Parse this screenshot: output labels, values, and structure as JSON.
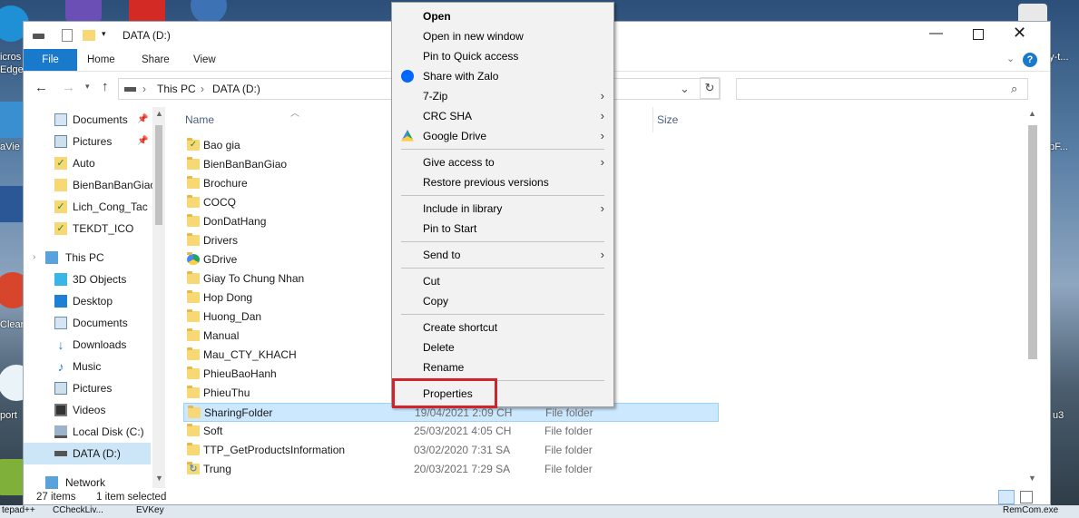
{
  "desktop": {
    "left_labels": [
      "icros",
      "Edge",
      "aVie",
      "Clean",
      "port"
    ],
    "right_labels": [
      "ay-t...",
      "upF...",
      "u3"
    ],
    "taskbar_items": [
      "tepad++",
      "CCheckLiv...",
      "EVKey",
      "RemCom.exe"
    ]
  },
  "window": {
    "title": "DATA (D:)",
    "ribbon_tabs": [
      "File",
      "Home",
      "Share",
      "View"
    ],
    "address_segments": [
      "This PC",
      "DATA (D:)"
    ],
    "search_placeholder": "",
    "columns": {
      "name": "Name",
      "size": "Size"
    },
    "nav": {
      "quick_access": [
        {
          "label": "Documents",
          "icon": "documents-icon",
          "pinned": true
        },
        {
          "label": "Pictures",
          "icon": "pictures-icon",
          "pinned": true
        },
        {
          "label": "Auto",
          "icon": "folder-check-icon"
        },
        {
          "label": "BienBanBanGiao",
          "icon": "folder-icon"
        },
        {
          "label": "Lich_Cong_Tac",
          "icon": "folder-check-icon"
        },
        {
          "label": "TEKDT_ICO",
          "icon": "folder-check-icon"
        }
      ],
      "this_pc_label": "This PC",
      "this_pc": [
        {
          "label": "3D Objects",
          "icon": "3d-objects-icon"
        },
        {
          "label": "Desktop",
          "icon": "desktop-icon"
        },
        {
          "label": "Documents",
          "icon": "documents-icon"
        },
        {
          "label": "Downloads",
          "icon": "downloads-icon"
        },
        {
          "label": "Music",
          "icon": "music-icon"
        },
        {
          "label": "Pictures",
          "icon": "pictures-icon"
        },
        {
          "label": "Videos",
          "icon": "videos-icon"
        },
        {
          "label": "Local Disk (C:)",
          "icon": "drive-icon"
        },
        {
          "label": "DATA (D:)",
          "icon": "drive-icon"
        }
      ],
      "network_label": "Network"
    },
    "files": [
      {
        "name": "Bao gia",
        "date": "",
        "type": "",
        "icon": "folder-check-icon"
      },
      {
        "name": "BienBanBanGiao",
        "date": "",
        "type": ""
      },
      {
        "name": "Brochure",
        "date": "",
        "type": ""
      },
      {
        "name": "COCQ",
        "date": "",
        "type": ""
      },
      {
        "name": "DonDatHang",
        "date": "",
        "type": ""
      },
      {
        "name": "Drivers",
        "date": "",
        "type": ""
      },
      {
        "name": "GDrive",
        "date": "",
        "type": "",
        "icon": "google-drive-icon"
      },
      {
        "name": "Giay To Chung Nhan",
        "date": "",
        "type": ""
      },
      {
        "name": "Hop Dong",
        "date": "",
        "type": ""
      },
      {
        "name": "Huong_Dan",
        "date": "",
        "type": ""
      },
      {
        "name": "Manual",
        "date": "",
        "type": ""
      },
      {
        "name": "Mau_CTY_KHACH",
        "date": "",
        "type": ""
      },
      {
        "name": "PhieuBaoHanh",
        "date": "",
        "type": ""
      },
      {
        "name": "PhieuThu",
        "date": "",
        "type": ""
      },
      {
        "name": "SharingFolder",
        "date": "19/04/2021 2:09 CH",
        "type": "File folder",
        "selected": true
      },
      {
        "name": "Soft",
        "date": "25/03/2021 4:05 CH",
        "type": "File folder"
      },
      {
        "name": "TTP_GetProductsInformation",
        "date": "03/02/2020 7:31 SA",
        "type": "File folder"
      },
      {
        "name": "Trung",
        "date": "20/03/2021 7:29 SA",
        "type": "File folder",
        "icon": "sync-folder-icon"
      }
    ],
    "status": {
      "count": "27 items",
      "selection": "1 item selected"
    }
  },
  "context_menu": {
    "items": [
      {
        "label": "Open",
        "bold": true
      },
      {
        "label": "Open in new window"
      },
      {
        "label": "Pin to Quick access"
      },
      {
        "label": "Share with Zalo",
        "icon": "zalo-icon"
      },
      {
        "label": "7-Zip",
        "submenu": true
      },
      {
        "label": "CRC SHA",
        "submenu": true
      },
      {
        "label": "Google Drive",
        "submenu": true,
        "icon": "google-drive-icon"
      },
      {
        "separator": true
      },
      {
        "label": "Give access to",
        "submenu": true
      },
      {
        "label": "Restore previous versions"
      },
      {
        "separator": true
      },
      {
        "label": "Include in library",
        "submenu": true
      },
      {
        "label": "Pin to Start"
      },
      {
        "separator": true
      },
      {
        "label": "Send to",
        "submenu": true
      },
      {
        "separator": true
      },
      {
        "label": "Cut"
      },
      {
        "label": "Copy"
      },
      {
        "separator": true
      },
      {
        "label": "Create shortcut"
      },
      {
        "label": "Delete"
      },
      {
        "label": "Rename"
      },
      {
        "separator": true
      },
      {
        "label": "Properties",
        "highlighted": true
      }
    ],
    "highlight_color": "#d1232a"
  }
}
